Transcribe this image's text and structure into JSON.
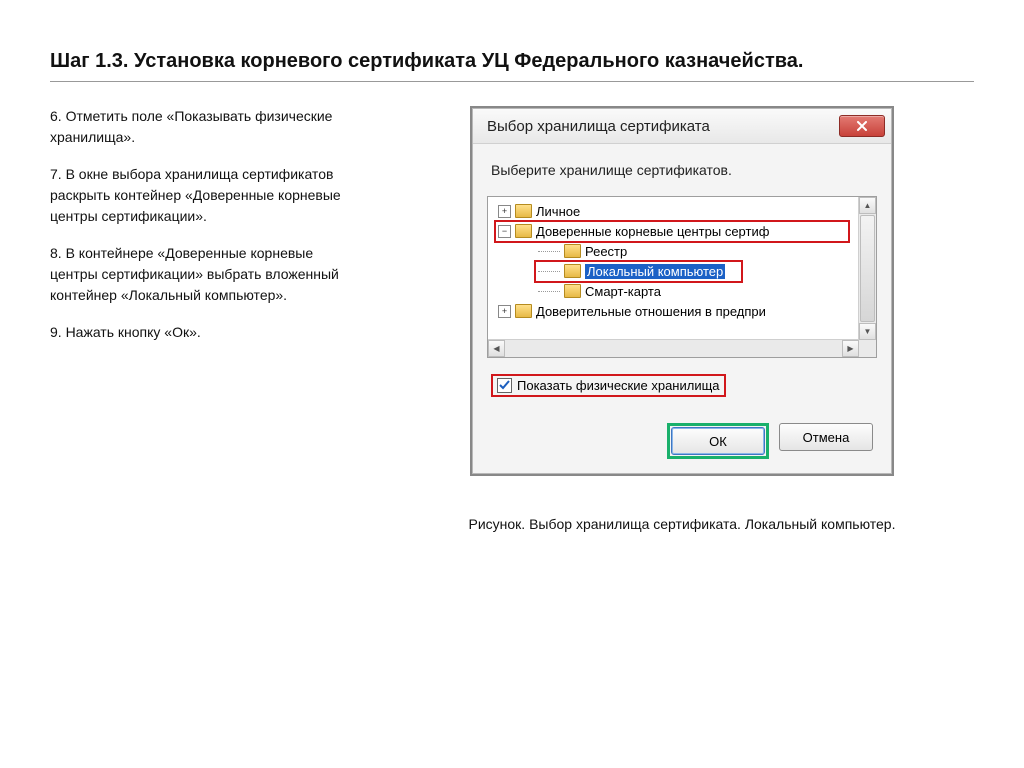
{
  "heading": "Шаг 1.3. Установка корневого сертификата УЦ Федерального казначейства.",
  "steps": {
    "s6": "6. Отметить поле «Показывать физические хранилища».",
    "s7": "7. В окне выбора хранилища сертификатов раскрыть контейнер «Доверенные корневые центры сертификации».",
    "s8": "8. В контейнере «Доверенные корневые центры сертификации» выбрать вложенный контейнер «Локальный компьютер».",
    "s9": "9. Нажать кнопку «Ок»."
  },
  "dialog": {
    "title": "Выбор хранилища сертификата",
    "body_text": "Выберите хранилище сертификатов.",
    "tree": {
      "personal": "Личное",
      "trusted_root": "Доверенные корневые центры сертиф",
      "registry": "Реестр",
      "local_computer": "Локальный компьютер",
      "smart_card": "Смарт-карта",
      "trusted_rel": "Доверительные отношения в предпри"
    },
    "checkbox_label": "Показать физические хранилища",
    "ok_label": "ОК",
    "cancel_label": "Отмена"
  },
  "caption": "Рисунок. Выбор хранилища сертификата. Локальный компьютер."
}
